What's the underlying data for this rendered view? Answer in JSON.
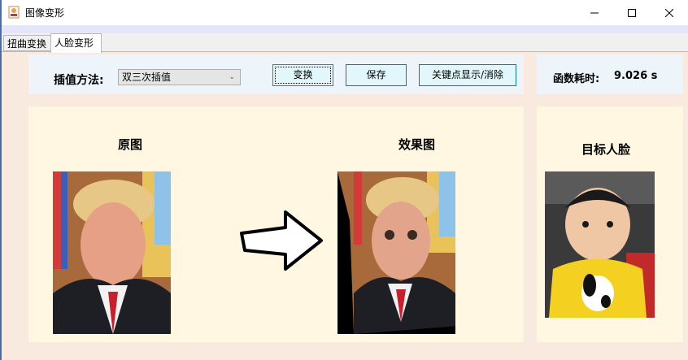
{
  "window": {
    "title": "图像变形"
  },
  "tabs": [
    {
      "label": "扭曲变换"
    },
    {
      "label": "人脸变形"
    }
  ],
  "toolbar": {
    "interp_label": "插值方法:",
    "interp_value": "双三次插值",
    "transform_button": "变换",
    "save_button": "保存",
    "keypoint_button": "关键点显示/消除"
  },
  "timing": {
    "label": "函数耗时:",
    "value": "9.026  s"
  },
  "cards": {
    "original_title": "原图",
    "result_title": "效果图",
    "target_title": "目标人脸"
  },
  "colors": {
    "panel_bg": "#f9eadf",
    "toolbar_bg": "#edf5fb",
    "card_bg": "#fff7e1",
    "button_bg": "#e1f7fb",
    "button_border": "#0b7aa8"
  }
}
